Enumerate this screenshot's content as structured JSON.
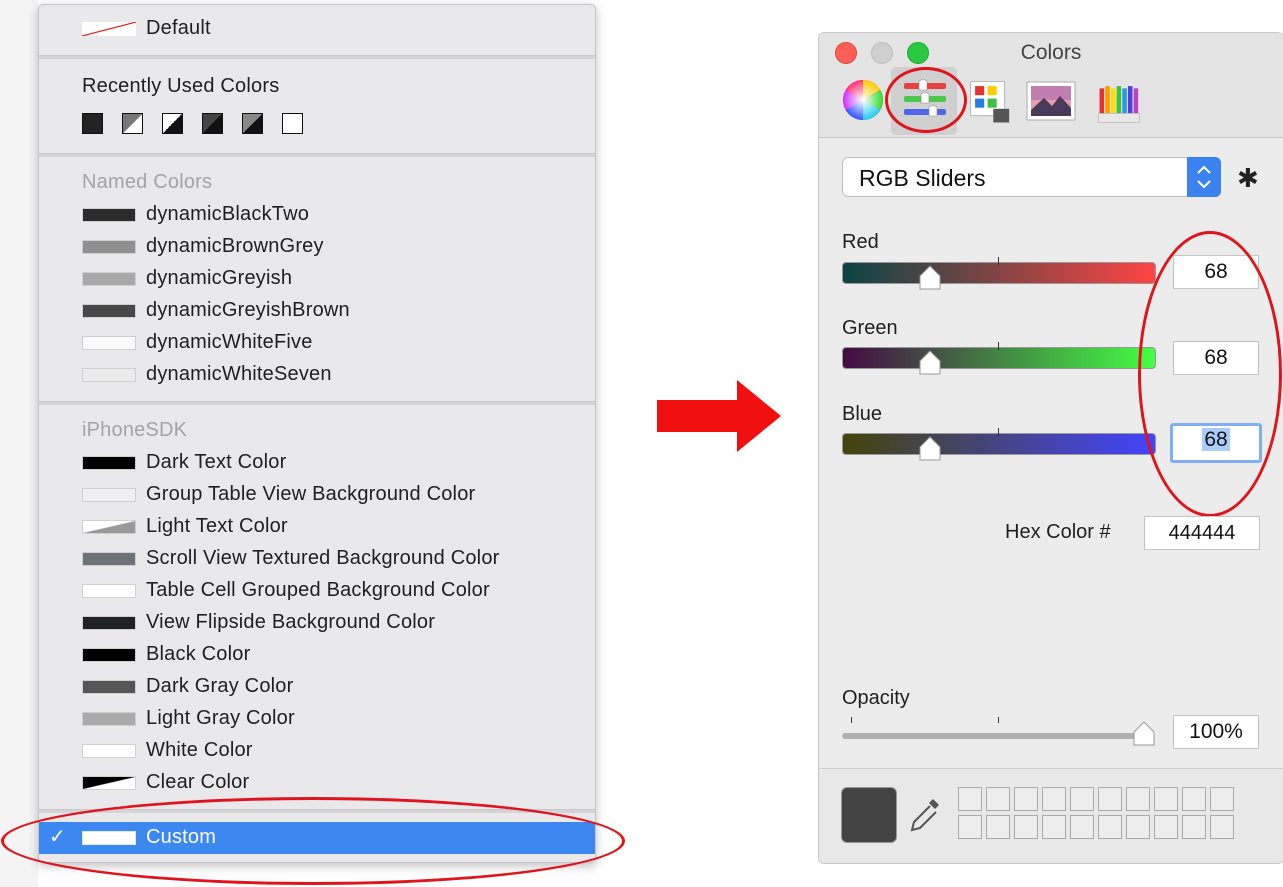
{
  "menu": {
    "default_label": "Default",
    "recent_header": "Recently Used Colors",
    "recent_count": 6,
    "named_header": "Named Colors",
    "named": [
      {
        "label": "dynamicBlackTwo",
        "color": "#2c2c2c"
      },
      {
        "label": "dynamicBrownGrey",
        "color": "#8f8f8f"
      },
      {
        "label": "dynamicGreyish",
        "color": "#a8a8a8"
      },
      {
        "label": "dynamicGreyishBrown",
        "color": "#474747"
      },
      {
        "label": "dynamicWhiteFive",
        "color": "#fafafa"
      },
      {
        "label": "dynamicWhiteSeven",
        "color": "#ececec"
      }
    ],
    "sdk_header": "iPhoneSDK",
    "sdk": [
      {
        "label": "Dark Text Color",
        "color": "#000000"
      },
      {
        "label": "Group Table View Background Color",
        "color": "#efeff4"
      },
      {
        "label": "Light Text Color",
        "color": "#999999"
      },
      {
        "label": "Scroll View Textured Background Color",
        "color": "#6f7178"
      },
      {
        "label": "Table Cell Grouped Background Color",
        "color": "#ffffff"
      },
      {
        "label": "View Flipside Background Color",
        "color": "#1f2124"
      },
      {
        "label": "Black Color",
        "color": "#000000"
      },
      {
        "label": "Dark Gray Color",
        "color": "#555555"
      },
      {
        "label": "Light Gray Color",
        "color": "#aaaaaa"
      },
      {
        "label": "White Color",
        "color": "#ffffff"
      },
      {
        "label": "Clear Color",
        "color": "#000000"
      }
    ],
    "custom_label": "Custom",
    "check_glyph": "✓"
  },
  "panel": {
    "title": "Colors",
    "mode": "RGB Sliders",
    "red_label": "Red",
    "green_label": "Green",
    "blue_label": "Blue",
    "red_value": "68",
    "green_value": "68",
    "blue_value": "68",
    "hex_label": "Hex Color #",
    "hex_value": "444444",
    "opacity_label": "Opacity",
    "opacity_value": "100%",
    "current_color": "#444444"
  },
  "accent": {
    "annotation_red": "#e0141b",
    "selection_blue": "#3d88f0"
  }
}
